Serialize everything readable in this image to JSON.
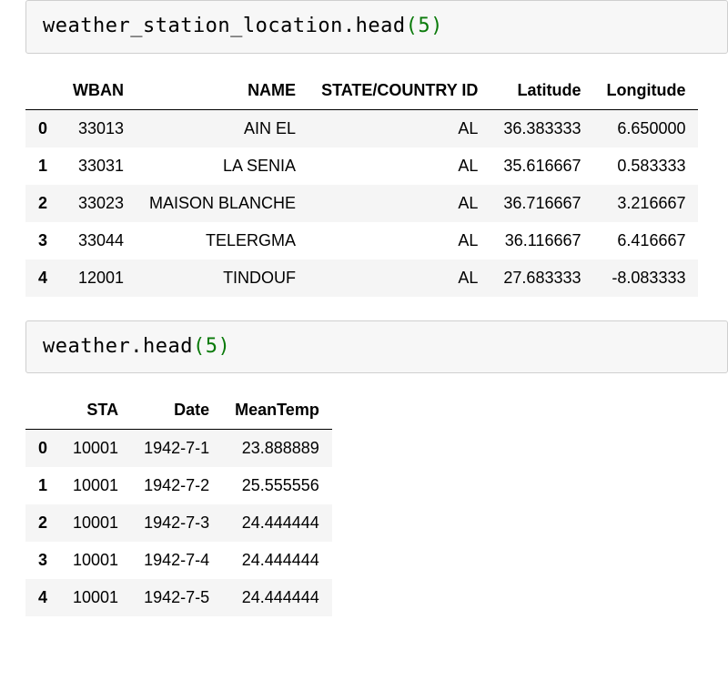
{
  "cells": [
    {
      "code_prefix": "weather_station_location.head",
      "code_arg": "5",
      "table": {
        "columns": [
          "WBAN",
          "NAME",
          "STATE/COUNTRY ID",
          "Latitude",
          "Longitude"
        ],
        "index": [
          "0",
          "1",
          "2",
          "3",
          "4"
        ],
        "rows": [
          [
            "33013",
            "AIN EL",
            "AL",
            "36.383333",
            "6.650000"
          ],
          [
            "33031",
            "LA SENIA",
            "AL",
            "35.616667",
            "0.583333"
          ],
          [
            "33023",
            "MAISON BLANCHE",
            "AL",
            "36.716667",
            "3.216667"
          ],
          [
            "33044",
            "TELERGMA",
            "AL",
            "36.116667",
            "6.416667"
          ],
          [
            "12001",
            "TINDOUF",
            "AL",
            "27.683333",
            "-8.083333"
          ]
        ]
      }
    },
    {
      "code_prefix": "weather.head",
      "code_arg": "5",
      "table": {
        "columns": [
          "STA",
          "Date",
          "MeanTemp"
        ],
        "index": [
          "0",
          "1",
          "2",
          "3",
          "4"
        ],
        "rows": [
          [
            "10001",
            "1942-7-1",
            "23.888889"
          ],
          [
            "10001",
            "1942-7-2",
            "25.555556"
          ],
          [
            "10001",
            "1942-7-3",
            "24.444444"
          ],
          [
            "10001",
            "1942-7-4",
            "24.444444"
          ],
          [
            "10001",
            "1942-7-5",
            "24.444444"
          ]
        ]
      }
    }
  ]
}
